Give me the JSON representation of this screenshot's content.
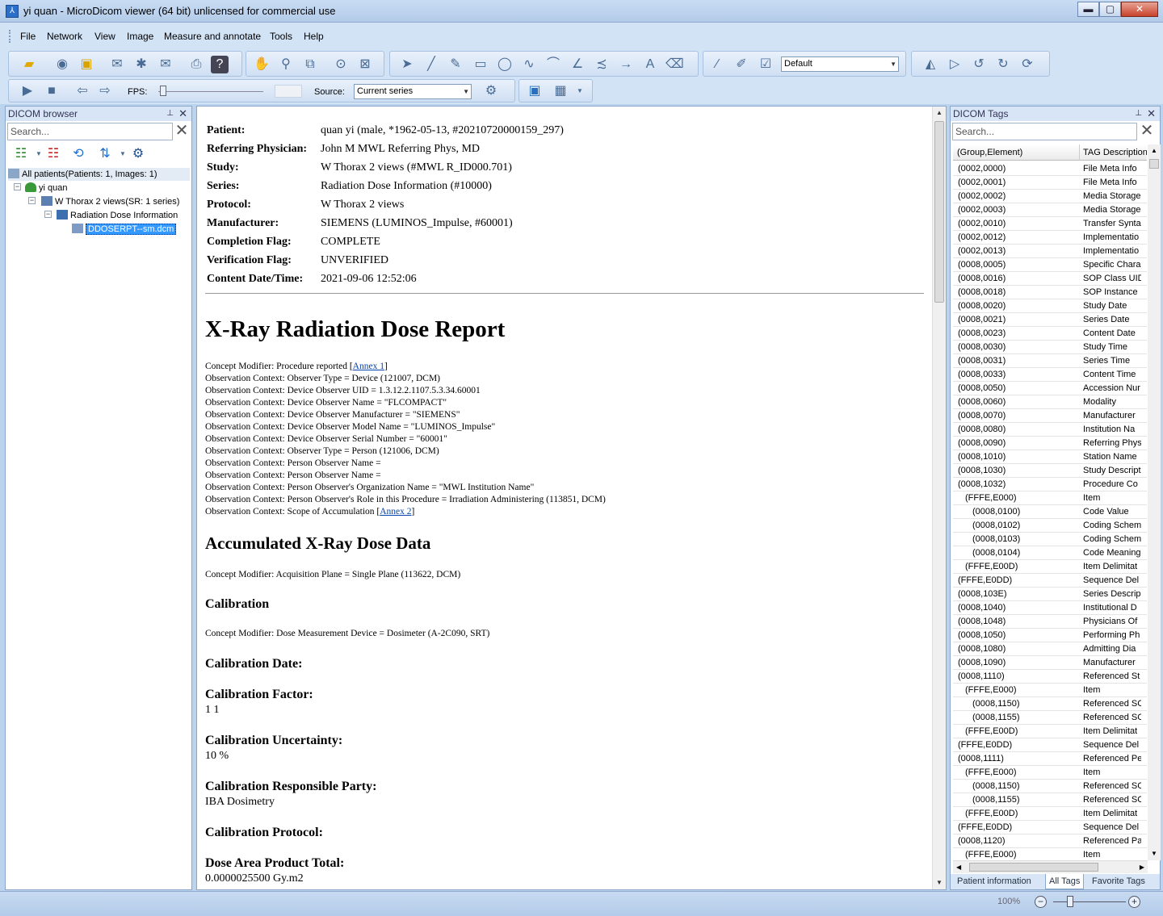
{
  "window": {
    "title": "yi quan - MicroDicom viewer (64 bit) unlicensed for commercial use",
    "buttons": {
      "minimize": "▬",
      "maximize": "▢",
      "close": "✕"
    }
  },
  "menu": [
    "File",
    "Network",
    "View",
    "Image",
    "Measure and annotate",
    "Tools",
    "Help"
  ],
  "toolbar": {
    "preset_value": "Default",
    "fps_label": "FPS:",
    "source_label": "Source:",
    "source_value": "Current series"
  },
  "browser": {
    "title": "DICOM browser",
    "search_placeholder": "Search...",
    "tree": [
      {
        "label": "All patients(Patients: 1, Images: 1)"
      },
      {
        "label": "yi quan"
      },
      {
        "label": "W Thorax 2 views(SR: 1 series)"
      },
      {
        "label": "Radiation Dose Information"
      },
      {
        "label": "DDOSERPT--sm.dcm"
      }
    ]
  },
  "report": {
    "header": [
      {
        "key": "Patient:",
        "value": "quan yi (male, *1962-05-13, #20210720000159_297)"
      },
      {
        "key": "Referring Physician:",
        "value": "John M MWL Referring Phys, MD"
      },
      {
        "key": "Study:",
        "value": "W Thorax 2 views (#MWL R_ID000.701)"
      },
      {
        "key": "Series:",
        "value": "Radiation Dose Information (#10000)"
      },
      {
        "key": "Protocol:",
        "value": "W Thorax 2 views"
      },
      {
        "key": "Manufacturer:",
        "value": "SIEMENS (LUMINOS_Impulse, #60001)"
      },
      {
        "key": "Completion Flag:",
        "value": "COMPLETE"
      },
      {
        "key": "Verification Flag:",
        "value": "UNVERIFIED"
      },
      {
        "key": "Content Date/Time:",
        "value": "2021-09-06 12:52:06"
      }
    ],
    "title": "X-Ray Radiation Dose Report",
    "concept_line": {
      "text": "Concept Modifier: Procedure reported [",
      "link": "Annex 1",
      "end": "]"
    },
    "observations": [
      "Observation Context: Observer Type = Device (121007, DCM)",
      "Observation Context: Device Observer UID = 1.3.12.2.1107.5.3.34.60001",
      "Observation Context: Device Observer Name = \"FLCOMPACT\"",
      "Observation Context: Device Observer Manufacturer = \"SIEMENS\"",
      "Observation Context: Device Observer Model Name = \"LUMINOS_Impulse\"",
      "Observation Context: Device Observer Serial Number = \"60001\"",
      "Observation Context: Observer Type = Person (121006, DCM)",
      "Observation Context: Person Observer Name =",
      "Observation Context: Person Observer Name =",
      "Observation Context: Person Observer's Organization Name = \"MWL Institution Name\"",
      "Observation Context: Person Observer's Role in this Procedure = Irradiation Administering (113851, DCM)"
    ],
    "scope_line": {
      "text": "Observation Context: Scope of Accumulation [",
      "link": "Annex 2",
      "end": "]"
    },
    "accum_title": "Accumulated X-Ray Dose Data",
    "accum_modifier": "Concept Modifier: Acquisition Plane = Single Plane (113622, DCM)",
    "calibration_title": "Calibration",
    "calibration_modifier": "Concept Modifier: Dose Measurement Device = Dosimeter (A-2C090, SRT)",
    "cal_date_label": "Calibration Date:",
    "cal_factor_label": "Calibration Factor:",
    "cal_factor_value": "1 1",
    "cal_uncert_label": "Calibration Uncertainty:",
    "cal_uncert_value": "10 %",
    "cal_party_label": "Calibration Responsible Party:",
    "cal_party_value": "IBA Dosimetry",
    "cal_protocol_label": "Calibration Protocol:",
    "dap_label": "Dose Area Product Total:",
    "dap_value": "0.0000025500 Gy.m2"
  },
  "tags": {
    "title": "DICOM Tags",
    "search_placeholder": "Search...",
    "col1": "(Group,Element)",
    "col2": "TAG Description",
    "rows": [
      {
        "g": "(0002,0000)",
        "d": "File Meta Info",
        "lvl": 0
      },
      {
        "g": "(0002,0001)",
        "d": "File Meta Info",
        "lvl": 0
      },
      {
        "g": "(0002,0002)",
        "d": "Media Storage",
        "lvl": 0
      },
      {
        "g": "(0002,0003)",
        "d": "Media Storage",
        "lvl": 0
      },
      {
        "g": "(0002,0010)",
        "d": "Transfer Synta",
        "lvl": 0
      },
      {
        "g": "(0002,0012)",
        "d": "Implementatio",
        "lvl": 0
      },
      {
        "g": "(0002,0013)",
        "d": "Implementatio",
        "lvl": 0
      },
      {
        "g": "(0008,0005)",
        "d": "Specific Chara",
        "lvl": 0
      },
      {
        "g": "(0008,0016)",
        "d": "SOP Class UID",
        "lvl": 0
      },
      {
        "g": "(0008,0018)",
        "d": "SOP Instance",
        "lvl": 0
      },
      {
        "g": "(0008,0020)",
        "d": "Study Date",
        "lvl": 0
      },
      {
        "g": "(0008,0021)",
        "d": "Series Date",
        "lvl": 0
      },
      {
        "g": "(0008,0023)",
        "d": "Content Date",
        "lvl": 0
      },
      {
        "g": "(0008,0030)",
        "d": "Study Time",
        "lvl": 0
      },
      {
        "g": "(0008,0031)",
        "d": "Series Time",
        "lvl": 0
      },
      {
        "g": "(0008,0033)",
        "d": "Content Time",
        "lvl": 0
      },
      {
        "g": "(0008,0050)",
        "d": "Accession Nur",
        "lvl": 0
      },
      {
        "g": "(0008,0060)",
        "d": "Modality",
        "lvl": 0
      },
      {
        "g": "(0008,0070)",
        "d": "Manufacturer",
        "lvl": 0
      },
      {
        "g": "(0008,0080)",
        "d": "Institution Na",
        "lvl": 0
      },
      {
        "g": "(0008,0090)",
        "d": "Referring Phys",
        "lvl": 0
      },
      {
        "g": "(0008,1010)",
        "d": "Station Name",
        "lvl": 0
      },
      {
        "g": "(0008,1030)",
        "d": "Study Descript",
        "lvl": 0
      },
      {
        "g": "(0008,1032)",
        "d": "Procedure Co",
        "lvl": 0
      },
      {
        "g": "(FFFE,E000)",
        "d": "Item",
        "lvl": 1
      },
      {
        "g": "(0008,0100)",
        "d": "Code Value",
        "lvl": 2
      },
      {
        "g": "(0008,0102)",
        "d": "Coding Schem",
        "lvl": 2
      },
      {
        "g": "(0008,0103)",
        "d": "Coding Schem",
        "lvl": 2
      },
      {
        "g": "(0008,0104)",
        "d": "Code Meaning",
        "lvl": 2
      },
      {
        "g": "(FFFE,E00D)",
        "d": "Item Delimitat",
        "lvl": 1
      },
      {
        "g": "(FFFE,E0DD)",
        "d": "Sequence Del",
        "lvl": 0
      },
      {
        "g": "(0008,103E)",
        "d": "Series Descrip",
        "lvl": 0
      },
      {
        "g": "(0008,1040)",
        "d": "Institutional D",
        "lvl": 0
      },
      {
        "g": "(0008,1048)",
        "d": "Physicians Of",
        "lvl": 0
      },
      {
        "g": "(0008,1050)",
        "d": "Performing Ph",
        "lvl": 0
      },
      {
        "g": "(0008,1080)",
        "d": "Admitting Dia",
        "lvl": 0
      },
      {
        "g": "(0008,1090)",
        "d": "Manufacturer",
        "lvl": 0
      },
      {
        "g": "(0008,1110)",
        "d": "Referenced St",
        "lvl": 0
      },
      {
        "g": "(FFFE,E000)",
        "d": "Item",
        "lvl": 1
      },
      {
        "g": "(0008,1150)",
        "d": "Referenced SC",
        "lvl": 2
      },
      {
        "g": "(0008,1155)",
        "d": "Referenced SC",
        "lvl": 2
      },
      {
        "g": "(FFFE,E00D)",
        "d": "Item Delimitat",
        "lvl": 1
      },
      {
        "g": "(FFFE,E0DD)",
        "d": "Sequence Del",
        "lvl": 0
      },
      {
        "g": "(0008,1111)",
        "d": "Referenced Pe",
        "lvl": 0
      },
      {
        "g": "(FFFE,E000)",
        "d": "Item",
        "lvl": 1
      },
      {
        "g": "(0008,1150)",
        "d": "Referenced SC",
        "lvl": 2
      },
      {
        "g": "(0008,1155)",
        "d": "Referenced SC",
        "lvl": 2
      },
      {
        "g": "(FFFE,E00D)",
        "d": "Item Delimitat",
        "lvl": 1
      },
      {
        "g": "(FFFE,E0DD)",
        "d": "Sequence Del",
        "lvl": 0
      },
      {
        "g": "(0008,1120)",
        "d": "Referenced Pa",
        "lvl": 0
      },
      {
        "g": "(FFFE,E000)",
        "d": "Item",
        "lvl": 1
      }
    ],
    "tabs": [
      "Patient information",
      "All Tags",
      "Favorite Tags"
    ]
  },
  "status": {
    "zoom": "100%"
  }
}
